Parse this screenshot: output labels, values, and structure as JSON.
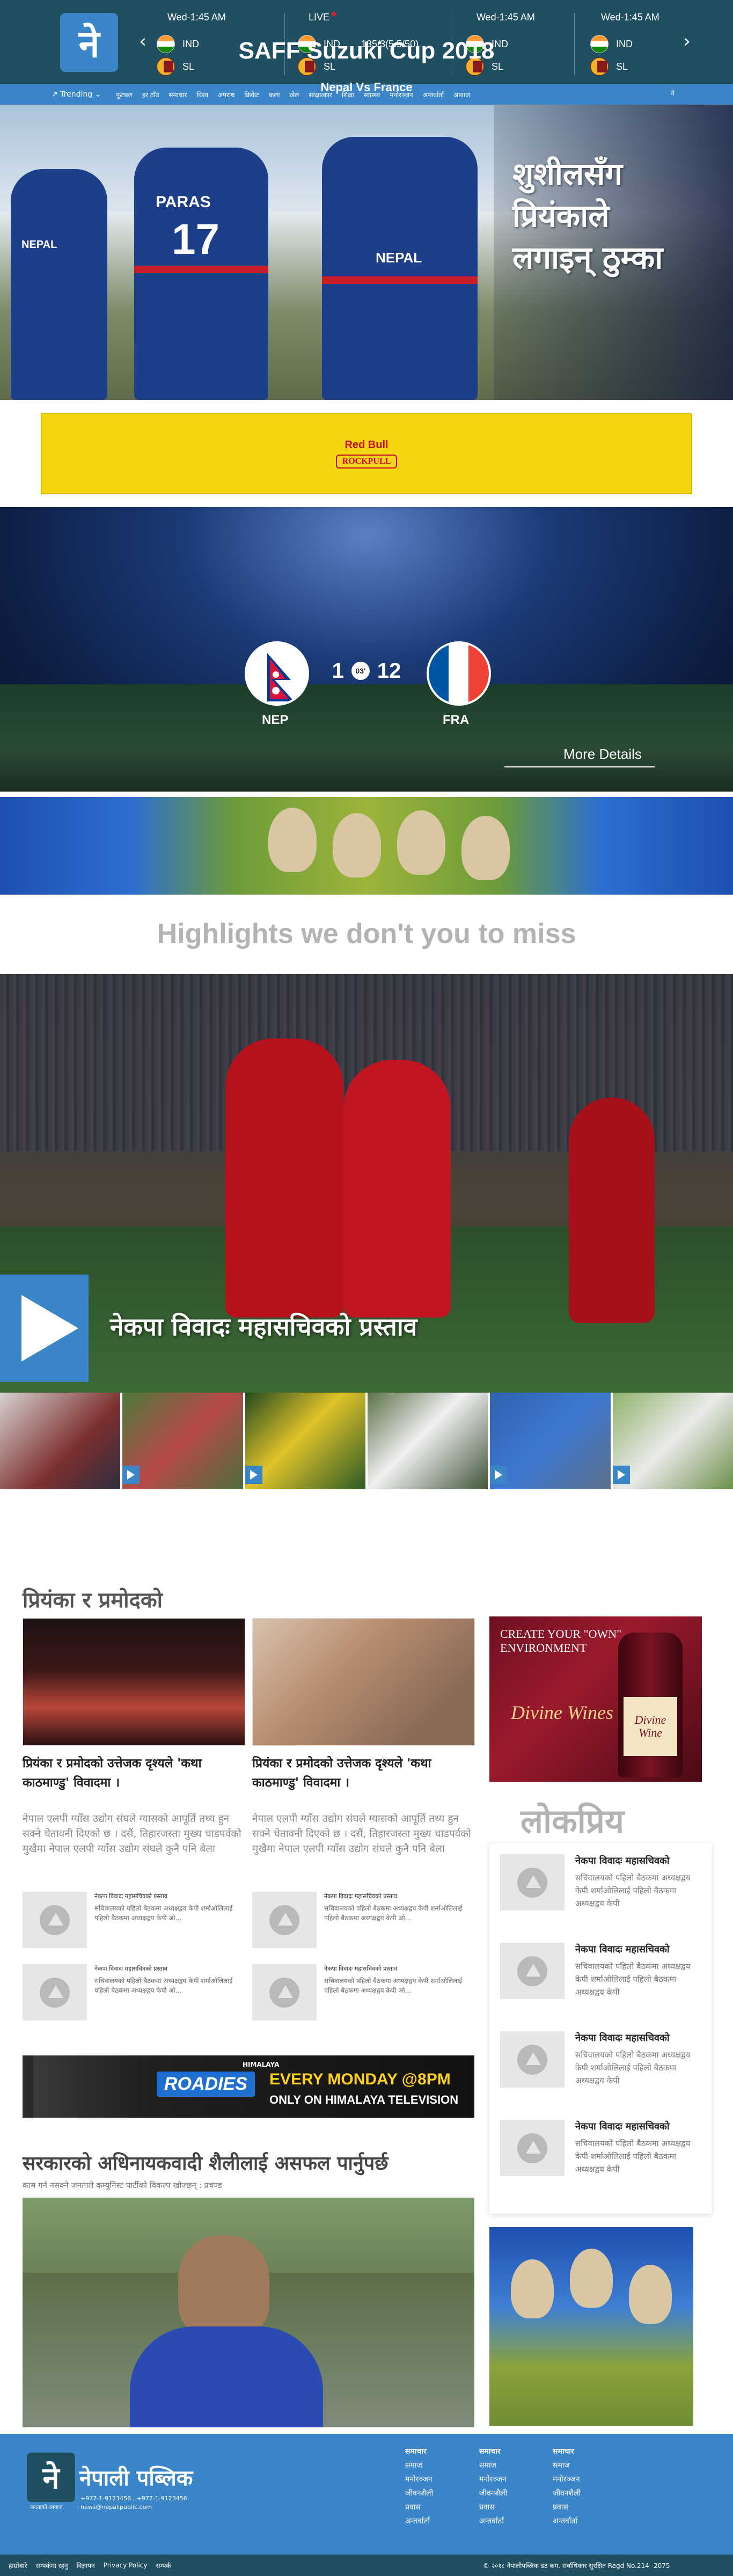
{
  "brand": {
    "logo_char": "ने",
    "footer_name": "नेपाली पब्लिक",
    "footer_contact_line1": "+977-1-9123456 , +977-1-9123456",
    "footer_contact_line2": "news@nepalipublic.com",
    "footer_tagline": "जनताको आवाज"
  },
  "scores": [
    {
      "status": "Wed-1:45 AM",
      "live": false,
      "team1": "IND",
      "team2": "SL",
      "score": ""
    },
    {
      "status": "LIVE",
      "live": true,
      "team1": "IND",
      "team2": "SL",
      "score": "135/3(5.5/50)"
    },
    {
      "status": "Wed-1:45 AM",
      "live": false,
      "team1": "IND",
      "team2": "SL",
      "score": ""
    },
    {
      "status": "Wed-1:45 AM",
      "live": false,
      "team1": "IND",
      "team2": "SL",
      "score": ""
    }
  ],
  "nav": {
    "trending": "Trending",
    "items": [
      "फुटबल",
      "हर ठाँउ",
      "समाचार",
      "विश्व",
      "अपराध",
      "क्रिकेट",
      "कला",
      "खेल",
      "साक्षात्कार",
      "शिक्षा",
      "स्वास्थ्य",
      "मनोरञ्जन",
      "अन्तर्वार्ता",
      "आवाज"
    ],
    "user_label": "ने"
  },
  "hero": {
    "title_line1": "शुशीलसँग",
    "title_line2": "प्रियंकाले",
    "title_line3": "लगाइन् ठुम्का",
    "jersey_name": "PARAS",
    "jersey_number": "17",
    "jersey_team1": "NEPAL",
    "jersey_team2": "NEPAL"
  },
  "ad_redbull": {
    "line1": "Red Bull",
    "line2": "ROCKPULL"
  },
  "saff": {
    "title": "SAFF Suzuki Cup 2018",
    "subtitle": "Nepal Vs France",
    "home": "NEP",
    "away": "FRA",
    "home_score": "1",
    "away_score": "12",
    "minute": "03'",
    "more": "More Details"
  },
  "highlights_heading": "Highlights we don't you to miss",
  "video": {
    "title": "नेकपा विवादः महासचिवको प्रस्ताव"
  },
  "thumb_count": 6,
  "section1": {
    "title": "प्रियंका र प्रमोदको",
    "cards": [
      {
        "headline": "प्रियंका र प्रमोदको उत्तेजक दृश्यले 'कथा काठमाण्डु' विवादमा ।",
        "body": "नेपाल एलपी ग्याँस उद्योग संघले ग्यासको आपूर्ति तथ्य हुन सक्ने चेतावनी दिएको छ । दसैं, तिहारजस्ता मुख्य चाडपर्वको मुखैमा नेपाल एलपी ग्याँस उद्योग संघले कुनै पनि बेला"
      },
      {
        "headline": "प्रियंका र प्रमोदको उत्तेजक दृश्यले 'कथा काठमाण्डु' विवादमा ।",
        "body": "नेपाल एलपी ग्याँस उद्योग संघले ग्यासको आपूर्ति तथ्य हुन सक्ने चेतावनी दिएको छ । दसैं, तिहारजस्ता मुख्य चाडपर्वको मुखैमा नेपाल एलपी ग्याँस उद्योग संघले कुनै पनि बेला"
      }
    ],
    "minis": [
      {
        "title": "नेकपा विवादः महासचिवको प्रस्ताव",
        "body": "सचिवालयको पहिलो बैठकमा अध्यक्षद्वय केपी शर्माओलिलाई पहिलो बैठकमा अध्यक्षद्वय केपी ओ..."
      },
      {
        "title": "नेकपा विवादः महासचिवको प्रस्ताव",
        "body": "सचिवालयको पहिलो बैठकमा अध्यक्षद्वय केपी शर्माओलिलाई पहिलो बैठकमा अध्यक्षद्वय केपी ओ..."
      },
      {
        "title": "नेकपा विवादः महासचिवको प्रस्ताव",
        "body": "सचिवालयको पहिलो बैठकमा अध्यक्षद्वय केपी शर्माओलिलाई पहिलो बैठकमा अध्यक्षद्वय केपी ओ..."
      },
      {
        "title": "नेकपा विवादः महासचिवको प्रस्ताव",
        "body": "सचिवालयको पहिलो बैठकमा अध्यक्षद्वय केपी शर्माओलिलाई पहिलो बैठकमा अध्यक्षद्वय केपी ओ..."
      }
    ]
  },
  "ad_wine": {
    "line1": "CREATE YOUR \"OWN\"",
    "line2": "ENVIRONMENT",
    "brand": "Divine Wines",
    "label": "Divine Wine"
  },
  "popular": {
    "title": "लोकप्रिय",
    "items": [
      {
        "title": "नेकपा विवादः महासचिवको",
        "body": "सचिवालयको पहिलो बैठकमा अध्यक्षद्वय केपी शर्माओलिलाई पहिलो बैठकमा अध्यक्षद्वय केपी"
      },
      {
        "title": "नेकपा विवादः महासचिवको",
        "body": "सचिवालयको पहिलो बैठकमा अध्यक्षद्वय केपी शर्माओलिलाई पहिलो बैठकमा अध्यक्षद्वय केपी"
      },
      {
        "title": "नेकपा विवादः महासचिवको",
        "body": "सचिवालयको पहिलो बैठकमा अध्यक्षद्वय केपी शर्माओलिलाई पहिलो बैठकमा अध्यक्षद्वय केपी"
      },
      {
        "title": "नेकपा विवादः महासचिवको",
        "body": "सचिवालयको पहिलो बैठकमा अध्यक्षद्वय केपी शर्माओलिलाई पहिलो बैठकमा अध्यक्षद्वय केपी"
      }
    ]
  },
  "ad_roadies": {
    "brand": "ROADIES",
    "tag": "EVERY MONDAY @8PM",
    "sub": "ONLY ON HIMALAYA TELEVISION",
    "channel": "HIMALAYA"
  },
  "lead": {
    "title": "सरकारको अधिनायकवादी शैलीलाई असफल पार्नुपर्छ",
    "subtitle": "काम गर्न नसक्ने जनताले कम्युनिस्ट पार्टीको विकल्प खोज्छन् : प्रचण्ड"
  },
  "footer": {
    "columns": [
      {
        "heading": "समाचार",
        "items": [
          "समाज",
          "मनोरञ्जन",
          "जीवनशैली",
          "प्रवास",
          "अन्तर्वार्ता"
        ]
      },
      {
        "heading": "समाचार",
        "items": [
          "समाज",
          "मनोरञ्जन",
          "जीवनशैली",
          "प्रवास",
          "अन्तर्वार्ता"
        ]
      },
      {
        "heading": "समाचार",
        "items": [
          "समाज",
          "मनोरञ्जन",
          "जीवनशैली",
          "प्रवास",
          "अन्तर्वार्ता"
        ]
      }
    ],
    "bottom_links": [
      "हाम्रोबारे",
      "सम्पर्कमा रहनु",
      "विज्ञापन",
      "Privacy Policy",
      "सम्पर्क"
    ],
    "copyright": "© २०१८ नेपालीपब्लिक डट कम. सर्वाधिकार सुरक्षित Regd No.214 -2075"
  },
  "colors": {
    "primary": "#3a86c8",
    "dark": "#1f4f61",
    "grey_heading": "#b3b3b3"
  }
}
